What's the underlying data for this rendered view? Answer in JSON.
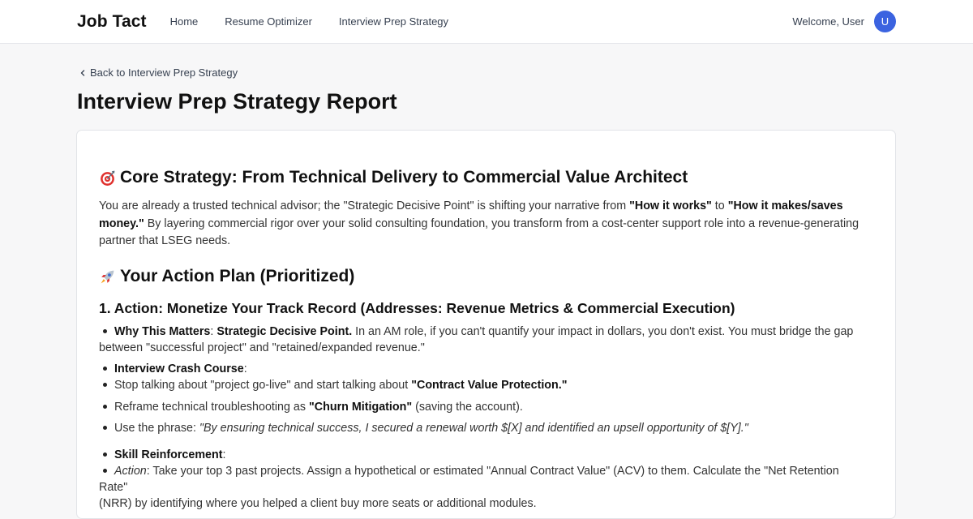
{
  "brand": "Job Tact",
  "nav": [
    "Home",
    "Resume Optimizer",
    "Interview Prep Strategy"
  ],
  "user": {
    "welcome": "Welcome, User",
    "initial": "U"
  },
  "back_link": "Back to Interview Prep Strategy",
  "page_title": "Interview Prep Strategy Report",
  "core": {
    "heading": "Core Strategy: From Technical Delivery to Commercial Value Architect",
    "p1": "You are already a trusted technical advisor; the \"Strategic Decisive Point\" is shifting your narrative from ",
    "b1": "\"How it works\"",
    "p2": " to ",
    "b2": "\"How it makes/saves",
    "b2b": "money.\"",
    "p3": " By layering commercial rigor over your solid consulting foundation, you transform from a cost-center support role into a revenue-generating",
    "p4": "partner that LSEG needs."
  },
  "action_plan": {
    "heading": "Your Action Plan (Prioritized)",
    "item1_heading": "1. Action: Monetize Your Track Record (Addresses: Revenue Metrics & Commercial Execution)",
    "why_label": "Why This Matters",
    "why_sep": ": ",
    "why_bold": "Strategic Decisive Point.",
    "why_text": " In an AM role, if you can't quantify your impact in dollars, you don't exist. You must bridge the gap",
    "why_text2": "between \"successful project\" and \"retained/expanded revenue.\"",
    "crash_label": "Interview Crash Course",
    "crash_colon": ":",
    "crash1_a": "Stop talking about \"project go-live\" and start talking about ",
    "crash1_b": "\"Contract Value Protection.\"",
    "crash2_a": "Reframe technical troubleshooting as ",
    "crash2_b": "\"Churn Mitigation\"",
    "crash2_c": " (saving the account).",
    "crash3_a": "Use the phrase: ",
    "crash3_b": "\"By ensuring technical success, I secured a renewal worth $[X] and identified an upsell opportunity of $[Y].\"",
    "skill_label": "Skill Reinforcement",
    "skill_colon": ":",
    "skill_action": "Action",
    "skill_text": ": Take your top 3 past projects. Assign a hypothetical or estimated \"Annual Contract Value\" (ACV) to them. Calculate the \"Net Retention Rate\"",
    "skill_text2": "(NRR) by identifying where you helped a client buy more seats or additional modules."
  }
}
